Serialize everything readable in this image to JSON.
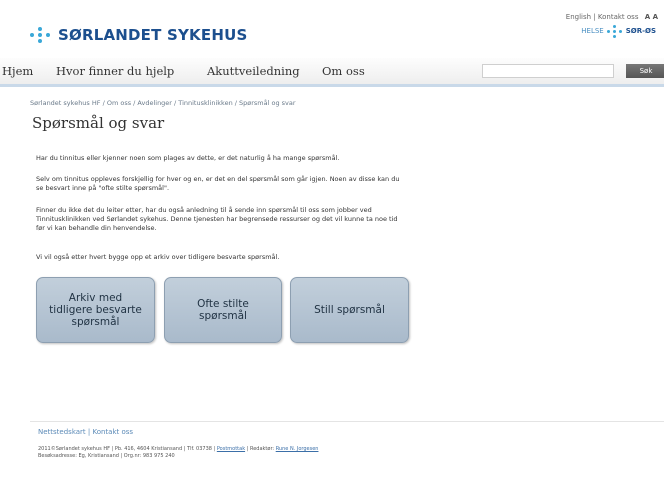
{
  "header": {
    "logo_text": "SØRLANDET SYKEHUS",
    "util_links": "English | Kontakt oss",
    "font_sizes": "A A",
    "partner_prefix": "HELSE",
    "partner_name": "SØR-ØS"
  },
  "nav": {
    "items": [
      "Hjem",
      "Hvor finner du hjelp",
      "Akuttveiledning",
      "Om oss"
    ],
    "search_placeholder": "",
    "search_button": "Søk"
  },
  "breadcrumb": "Sørlandet sykehus HF / Om oss / Avdelinger / Tinnitusklinikken / Spørsmål og svar",
  "page_title": "Spørsmål og svar",
  "paragraphs": [
    "Har du tinnitus eller kjenner noen som plages av dette, er det naturlig å ha mange spørsmål.",
    "Selv om tinnitus oppleves forskjellig for hver og en, er det en del spørsmål som går igjen. Noen av disse kan du",
    "se besvart inne på \"ofte stilte spørsmål\".",
    "Finner du ikke det du leiter etter, har du også anledning til å sende inn spørsmål til oss som jobber ved",
    "Tinnitusklinikken ved Sørlandet sykehus. Denne tjenesten har begrensede ressurser og det vil kunne ta noe tid",
    "før vi kan behandle din henvendelse.",
    "Vi vil også etter hvert bygge opp et arkiv over tidligere besvarte spørsmål."
  ],
  "buttons": {
    "archive": [
      "Arkiv med",
      "tidligere besvarte",
      "spørsmål"
    ],
    "faq": [
      "Ofte stilte",
      "spørsmål"
    ],
    "ask": [
      "Still spørsmål"
    ]
  },
  "footer": {
    "links": "Nettstedskart | Kontakt oss",
    "line1": "2011©Sørlandet sykehus HF | Pb. 416, 4604 Kristiansand | Tlf. 03738 |",
    "line1_link": "Postmottak",
    "line1_end": "| Redaktør:",
    "editor": "Rune N. Jorgesen",
    "line2": "Besøksadresse: Eg, Kristiansand | Org.nr: 983 975 240"
  },
  "colors": {
    "brand_blue": "#1c4f8e",
    "dot_blue": "#3aa8d8",
    "button_fill": "#b6c5d4"
  }
}
